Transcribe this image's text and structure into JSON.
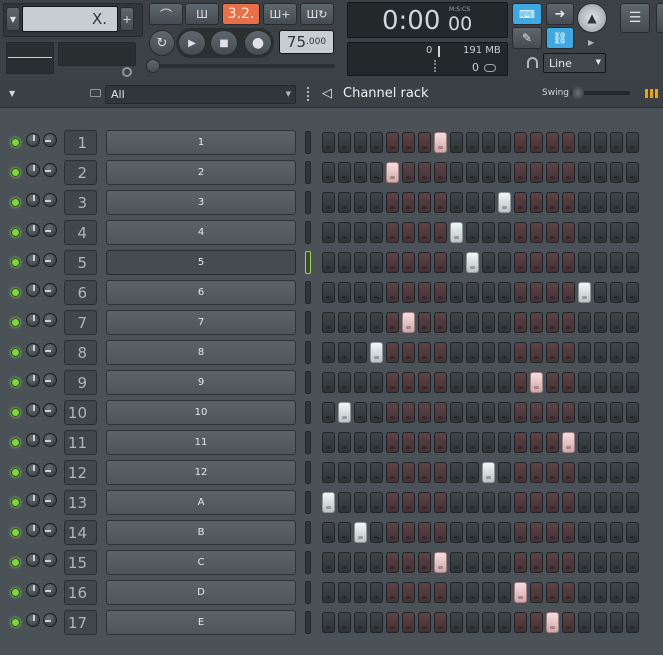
{
  "toolbar": {
    "pattern_selector": "X.",
    "pattern_add": "+",
    "tempo": "75",
    "tempo_decimal": ".000",
    "time_display": "0:00",
    "time_display_small": "00",
    "time_format": "M:S:CS",
    "cpu_value": "0",
    "memory": "191 MB",
    "polyphony": "0",
    "snap_mode": "Line",
    "song_position_label": "3.2."
  },
  "rack": {
    "filter_value": "All",
    "title": "Channel rack",
    "swing_label": "Swing"
  },
  "colors": {
    "accent_green": "#7bd93f",
    "step_on": "#e8ecee",
    "step_red": "#5c4346",
    "step_dark": "#3f4549",
    "record_highlight": "#f5886a"
  },
  "channels": [
    {
      "number": "1",
      "name": "1",
      "active_step": 7
    },
    {
      "number": "2",
      "name": "2",
      "active_step": 4
    },
    {
      "number": "3",
      "name": "3",
      "active_step": 11
    },
    {
      "number": "4",
      "name": "4",
      "active_step": 8
    },
    {
      "number": "5",
      "name": "5",
      "active_step": 9,
      "selected": true
    },
    {
      "number": "6",
      "name": "6",
      "active_step": 16
    },
    {
      "number": "7",
      "name": "7",
      "active_step": 5
    },
    {
      "number": "8",
      "name": "8",
      "active_step": 3
    },
    {
      "number": "9",
      "name": "9",
      "active_step": 13
    },
    {
      "number": "10",
      "name": "10",
      "active_step": 1
    },
    {
      "number": "11",
      "name": "11",
      "active_step": 15
    },
    {
      "number": "12",
      "name": "12",
      "active_step": 10
    },
    {
      "number": "13",
      "name": "A",
      "active_step": 0
    },
    {
      "number": "14",
      "name": "B",
      "active_step": 2
    },
    {
      "number": "15",
      "name": "C",
      "active_step": 7
    },
    {
      "number": "16",
      "name": "D",
      "active_step": 12
    },
    {
      "number": "17",
      "name": "E",
      "active_step": 14
    }
  ]
}
